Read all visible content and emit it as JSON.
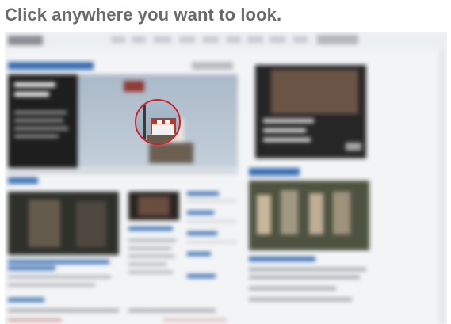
{
  "instruction": {
    "text": "Click anywhere you want to look."
  },
  "colors": {
    "title_text": "#6a6a6a",
    "focus_ring": "#d41e26",
    "link_blue": "#3a6fb3",
    "photo_dark": "#2b2b2b"
  },
  "icons": {
    "focus": "magnifier-circle"
  }
}
